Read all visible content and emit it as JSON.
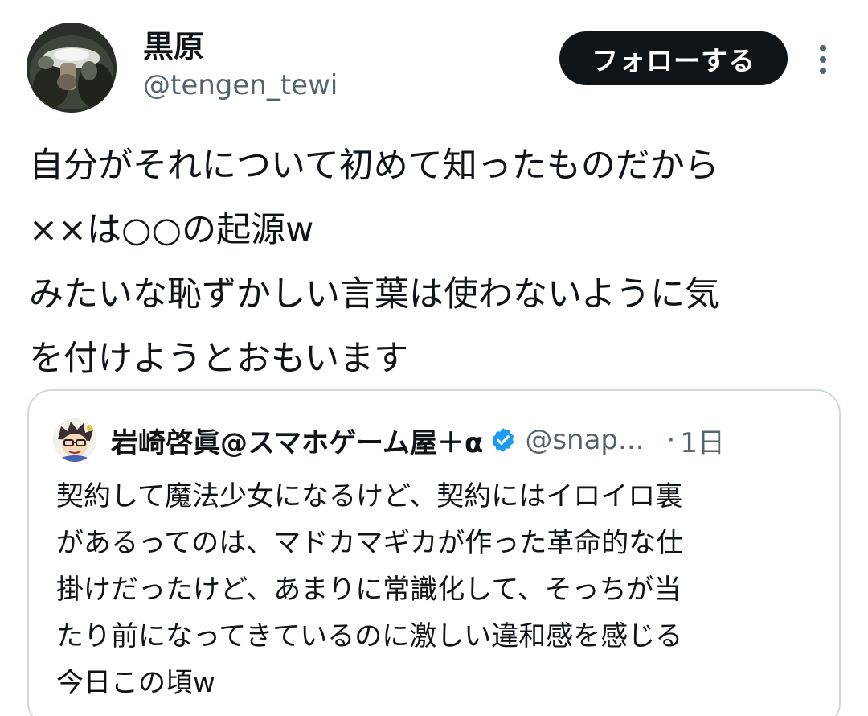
{
  "author": {
    "display_name": "黒原",
    "handle": "@tengen_tewi",
    "avatar_icon": "profile-photo"
  },
  "follow_button_label": "フォローする",
  "more_icon": "more-vertical-icon",
  "tweet_lines": [
    "自分がそれについて初めて知ったものだから",
    "××は○○の起源w",
    "みたいな恥ずかしい言葉は使わないように気",
    "を付けようとおもいます"
  ],
  "quoted_tweet": {
    "display_name": "岩崎啓眞@スマホゲーム屋＋α",
    "verified_icon": "verified-badge-icon",
    "handle": "@snap...",
    "separator": "·",
    "time": "1日",
    "text_lines": [
      "契約して魔法少女になるけど、契約にはイロイロ裏",
      "があるってのは、マドカマギカが作った革命的な仕",
      "掛けだったけど、あまりに常識化して、そっちが当",
      "たり前になってきているのに激しい違和感を感じる",
      "今日この頃w"
    ]
  },
  "colors": {
    "text": "#0f1419",
    "secondary": "#536471",
    "follow_bg": "#0f1419",
    "verified": "#1d9bf0",
    "border": "#cfd9de"
  }
}
